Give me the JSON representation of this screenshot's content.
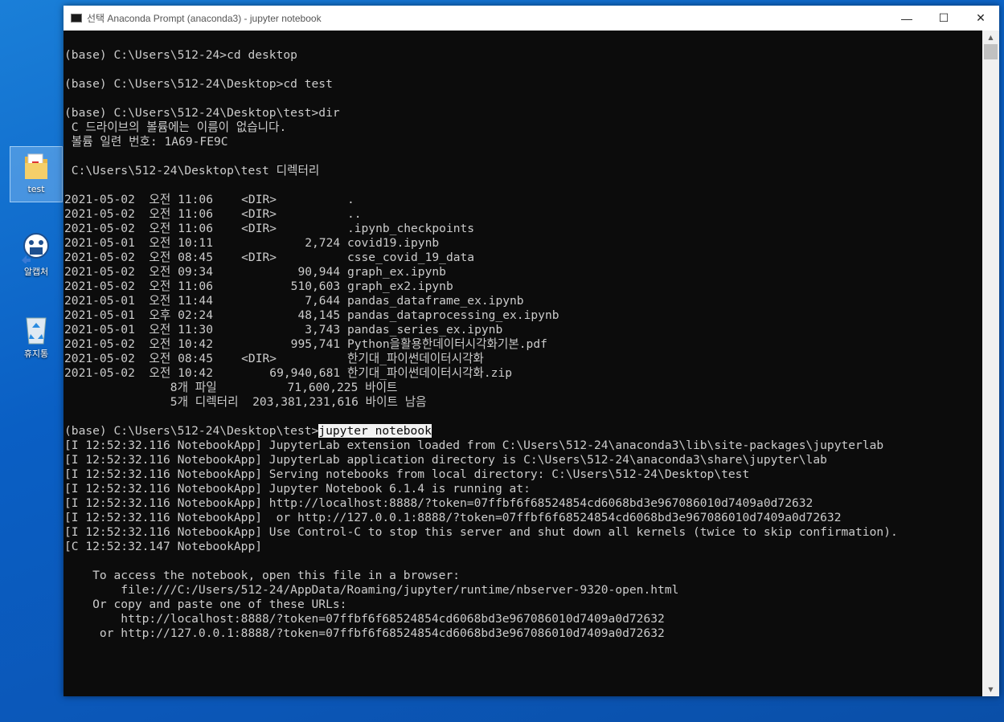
{
  "desktop": {
    "icons": [
      {
        "label": "test"
      },
      {
        "label": "알캡처"
      },
      {
        "label": "휴지통"
      }
    ]
  },
  "window": {
    "title": "선택 Anaconda Prompt (anaconda3) - jupyter  notebook",
    "controls": {
      "minimize": "—",
      "maximize": "☐",
      "close": "✕"
    }
  },
  "console": {
    "lines_before": [
      "",
      "(base) C:\\Users\\512-24>cd desktop",
      "",
      "(base) C:\\Users\\512-24\\Desktop>cd test",
      "",
      "(base) C:\\Users\\512-24\\Desktop\\test>dir",
      " C 드라이브의 볼륨에는 이름이 없습니다.",
      " 볼륨 일련 번호: 1A69-FE9C",
      "",
      " C:\\Users\\512-24\\Desktop\\test 디렉터리",
      "",
      "2021-05-02  오전 11:06    <DIR>          .",
      "2021-05-02  오전 11:06    <DIR>          ..",
      "2021-05-02  오전 11:06    <DIR>          .ipynb_checkpoints",
      "2021-05-01  오전 10:11             2,724 covid19.ipynb",
      "2021-05-02  오전 08:45    <DIR>          csse_covid_19_data",
      "2021-05-02  오전 09:34            90,944 graph_ex.ipynb",
      "2021-05-02  오전 11:06           510,603 graph_ex2.ipynb",
      "2021-05-01  오전 11:44             7,644 pandas_dataframe_ex.ipynb",
      "2021-05-01  오후 02:24            48,145 pandas_dataprocessing_ex.ipynb",
      "2021-05-01  오전 11:30             3,743 pandas_series_ex.ipynb",
      "2021-05-02  오전 10:42           995,741 Python을활용한데이터시각화기본.pdf",
      "2021-05-02  오전 08:45    <DIR>          한기대_파이썬데이터시각화",
      "2021-05-02  오전 10:42        69,940,681 한기대_파이썬데이터시각화.zip",
      "               8개 파일          71,600,225 바이트",
      "               5개 디렉터리  203,381,231,616 바이트 남음",
      ""
    ],
    "prompt": "(base) C:\\Users\\512-24\\Desktop\\test>",
    "selected_command": "jupyter notebook",
    "lines_after": [
      "[I 12:52:32.116 NotebookApp] JupyterLab extension loaded from C:\\Users\\512-24\\anaconda3\\lib\\site-packages\\jupyterlab",
      "[I 12:52:32.116 NotebookApp] JupyterLab application directory is C:\\Users\\512-24\\anaconda3\\share\\jupyter\\lab",
      "[I 12:52:32.116 NotebookApp] Serving notebooks from local directory: C:\\Users\\512-24\\Desktop\\test",
      "[I 12:52:32.116 NotebookApp] Jupyter Notebook 6.1.4 is running at:",
      "[I 12:52:32.116 NotebookApp] http://localhost:8888/?token=07ffbf6f68524854cd6068bd3e967086010d7409a0d72632",
      "[I 12:52:32.116 NotebookApp]  or http://127.0.0.1:8888/?token=07ffbf6f68524854cd6068bd3e967086010d7409a0d72632",
      "[I 12:52:32.116 NotebookApp] Use Control-C to stop this server and shut down all kernels (twice to skip confirmation).",
      "[C 12:52:32.147 NotebookApp]",
      "",
      "    To access the notebook, open this file in a browser:",
      "        file:///C:/Users/512-24/AppData/Roaming/jupyter/runtime/nbserver-9320-open.html",
      "    Or copy and paste one of these URLs:",
      "        http://localhost:8888/?token=07ffbf6f68524854cd6068bd3e967086010d7409a0d72632",
      "     or http://127.0.0.1:8888/?token=07ffbf6f68524854cd6068bd3e967086010d7409a0d72632"
    ]
  }
}
